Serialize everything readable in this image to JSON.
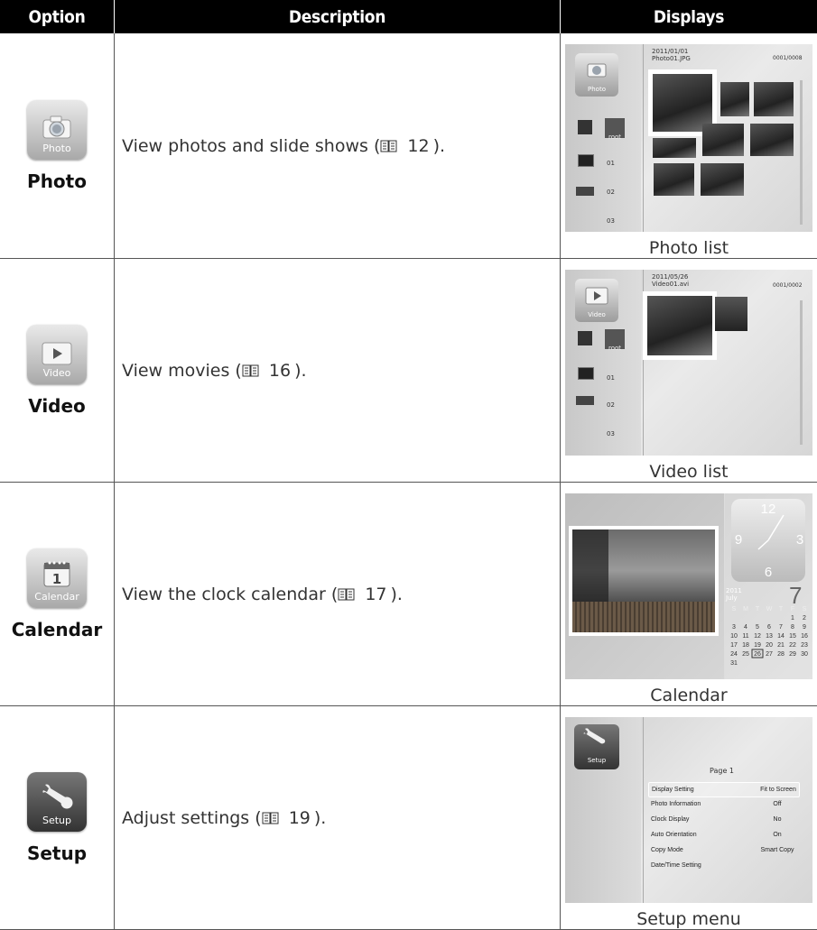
{
  "headers": {
    "option": "Option",
    "description": "Description",
    "displays": "Displays"
  },
  "rows": [
    {
      "option": "Photo",
      "icon_caption": "Photo",
      "icon": "camera-icon",
      "description_pre": "View photos and slide shows (",
      "page": "12",
      "description_post": ").",
      "caption": "Photo list",
      "screen": {
        "date": "2011/01/01",
        "file": "Photo01.JPG",
        "counter": "0001/0008",
        "app_label": "Photo",
        "folders": [
          "root",
          "01",
          "02",
          "03"
        ]
      }
    },
    {
      "option": "Video",
      "icon_caption": "Video",
      "icon": "play-icon",
      "description_pre": "View movies (",
      "page": "16",
      "description_post": ").",
      "caption": "Video list",
      "screen": {
        "date": "2011/05/26",
        "file": "Video01.avi",
        "counter": "0001/0002",
        "app_label": "Video",
        "folders": [
          "root",
          "01",
          "02",
          "03"
        ]
      }
    },
    {
      "option": "Calendar",
      "icon_caption": "Calendar",
      "icon": "calendar-icon",
      "description_pre": "View the clock calendar (",
      "page": "17",
      "description_post": ").",
      "caption": "Calendar",
      "screen": {
        "clock_numbers": [
          "12",
          "3",
          "6",
          "9"
        ],
        "year": "2011",
        "month": "July",
        "day": "7",
        "weekdays": [
          "S",
          "M",
          "T",
          "W",
          "T",
          "F",
          "S"
        ],
        "weeks": [
          [
            "",
            "",
            "",
            "",
            "",
            "1",
            "2"
          ],
          [
            "3",
            "4",
            "5",
            "6",
            "7",
            "8",
            "9"
          ],
          [
            "10",
            "11",
            "12",
            "13",
            "14",
            "15",
            "16"
          ],
          [
            "17",
            "18",
            "19",
            "20",
            "21",
            "22",
            "23"
          ],
          [
            "24",
            "25",
            "26",
            "27",
            "28",
            "29",
            "30"
          ],
          [
            "31",
            "",
            "",
            "",
            "",
            "",
            ""
          ]
        ],
        "highlighted": "26"
      }
    },
    {
      "option": "Setup",
      "icon_caption": "Setup",
      "icon": "wrench-icon",
      "description_pre": "Adjust settings (",
      "page": "19",
      "description_post": ").",
      "caption": "Setup menu",
      "screen": {
        "app_label": "Setup",
        "page_title": "Page 1",
        "menu": [
          {
            "label": "Display Setting",
            "value": "Fit to Screen",
            "selected": true
          },
          {
            "label": "Photo Information",
            "value": "Off"
          },
          {
            "label": "Clock Display",
            "value": "No"
          },
          {
            "label": "Auto Orientation",
            "value": "On"
          },
          {
            "label": "Copy Mode",
            "value": "Smart Copy"
          },
          {
            "label": "Date/Time Setting",
            "value": ""
          }
        ]
      }
    }
  ],
  "colors": {
    "header_bg": "#000000",
    "header_text": "#ffffff",
    "rule": "#555555"
  }
}
